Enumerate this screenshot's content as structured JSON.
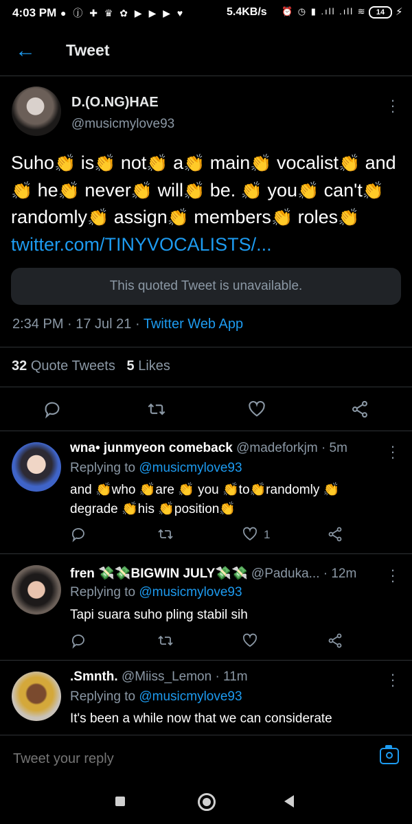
{
  "status_bar": {
    "time": "4:03 PM",
    "left_icons": "● ⓙ ✚ ♛ ✿ ▶ ▶ ▶ ♥",
    "speed": "5.4KB/s",
    "right_icons": "⏰ ◷ ▮ .ıll .ıll ≋",
    "battery": "14"
  },
  "header": {
    "title": "Tweet"
  },
  "tweet": {
    "author_name": "D.(O.NG)HAE",
    "author_handle": "@musicmylove93",
    "words": [
      "Suho",
      "is",
      "not",
      "a",
      "main",
      "vocalist",
      "and",
      "he",
      "never",
      "will",
      "be.",
      "you",
      "can't",
      "randomly",
      "assign",
      "members",
      "roles"
    ],
    "clap": "👏",
    "link": "twitter.com/TINYVOCALISTS/...",
    "quoted_unavailable": "This quoted Tweet is unavailable.",
    "time": "2:34 PM · 17 Jul 21 · ",
    "source": "Twitter Web App",
    "quote_count": "32",
    "quote_label": "Quote Tweets",
    "likes_count": "5",
    "likes_label": "Likes"
  },
  "icons": {
    "reply": "○",
    "retweet": "⇄",
    "like": "♡",
    "share": "share-icon"
  },
  "replies": [
    {
      "name": "wna• junmyeon comeback",
      "handle": "@madeforkjm · 5m",
      "replying_prefix": "Replying to ",
      "replying_to": "@musicmylove93",
      "text_line1": "and 👏who 👏are 👏 you 👏to👏randomly 👏",
      "text_line2": "degrade 👏his 👏position👏",
      "likes": "1"
    },
    {
      "name": "fren 💸💸BIGWIN JULY💸💸",
      "handle": "@Paduka... · 12m",
      "replying_prefix": "Replying to ",
      "replying_to": "@musicmylove93",
      "text_line1": "Tapi suara suho pling stabil sih",
      "likes": ""
    },
    {
      "name": ".Smnth.",
      "handle": "@Miiss_Lemon · 11m",
      "replying_prefix": "Replying to ",
      "replying_to": "@musicmylove93",
      "text_line1": "It's been a while now that we can considerate"
    }
  ],
  "reply_bar": {
    "placeholder": "Tweet your reply"
  },
  "colors": {
    "accent": "#1d9bf0",
    "background": "#000000",
    "muted": "#8b98a5"
  }
}
